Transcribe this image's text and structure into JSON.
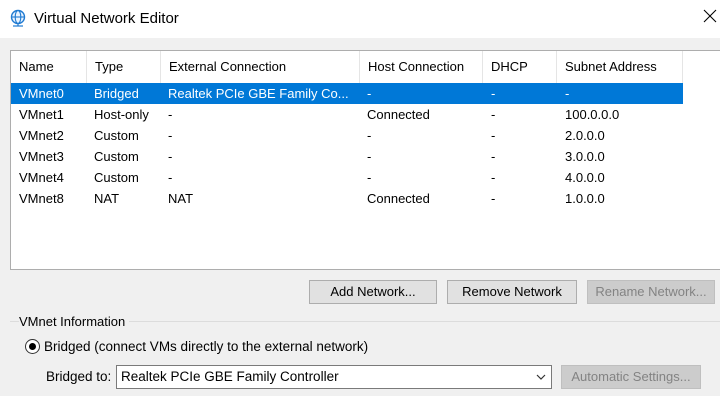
{
  "window": {
    "title": "Virtual Network Editor",
    "title_icon": "globe-network-icon",
    "close_icon": "close-icon"
  },
  "table": {
    "columns": [
      "Name",
      "Type",
      "External Connection",
      "Host Connection",
      "DHCP",
      "Subnet Address"
    ],
    "rows": [
      [
        "VMnet0",
        "Bridged",
        "Realtek PCIe GBE Family Co...",
        "-",
        "-",
        "-"
      ],
      [
        "VMnet1",
        "Host-only",
        "-",
        "Connected",
        "-",
        "100.0.0.0"
      ],
      [
        "VMnet2",
        "Custom",
        "-",
        "-",
        "-",
        "2.0.0.0"
      ],
      [
        "VMnet3",
        "Custom",
        "-",
        "-",
        "-",
        "3.0.0.0"
      ],
      [
        "VMnet4",
        "Custom",
        "-",
        "-",
        "-",
        "4.0.0.0"
      ],
      [
        "VMnet8",
        "NAT",
        "NAT",
        "Connected",
        "-",
        "1.0.0.0"
      ]
    ],
    "selected_row": 0
  },
  "buttons": {
    "add_network": "Add Network...",
    "remove_network": "Remove Network",
    "rename_network": "Rename Network..."
  },
  "vmnet_info": {
    "group_label": "VMnet Information",
    "bridged_radio_label": "Bridged (connect VMs directly to the external network)",
    "bridged_to_label": "Bridged to:",
    "bridged_to_value": "Realtek PCIe GBE Family Controller",
    "automatic_settings": "Automatic Settings..."
  },
  "colors": {
    "selection": "#0078d7",
    "window_bg": "#f0f0f0"
  }
}
